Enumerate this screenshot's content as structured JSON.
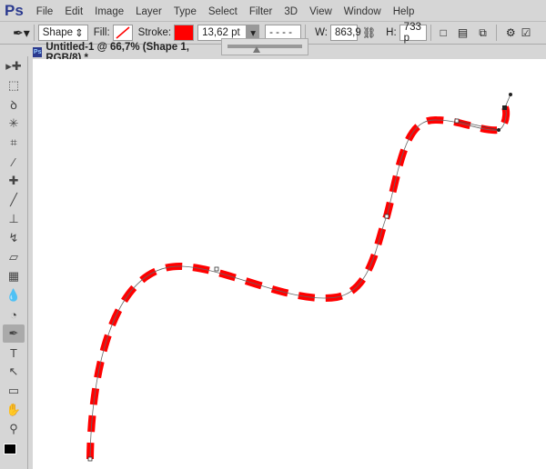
{
  "app": {
    "logo": "Ps"
  },
  "menu": [
    "File",
    "Edit",
    "Image",
    "Layer",
    "Type",
    "Select",
    "Filter",
    "3D",
    "View",
    "Window",
    "Help"
  ],
  "options": {
    "tool_icon": "pen-icon",
    "mode": "Shape",
    "fill_label": "Fill:",
    "stroke_label": "Stroke:",
    "stroke_color": "#ff0000",
    "stroke_width": "13,62 pt",
    "stroke_type": "- - - -",
    "w_label": "W:",
    "w_value": "863,9",
    "h_label": "H:",
    "h_value": "733 p"
  },
  "document": {
    "title": "Untitled-1 @ 66,7% (Shape 1, RGB/8) *"
  },
  "tools": [
    "move",
    "marquee",
    "lasso",
    "magic-wand",
    "crop",
    "eyedropper",
    "healing",
    "brush",
    "stamp",
    "history-brush",
    "eraser",
    "gradient",
    "blur",
    "dodge",
    "pen",
    "type",
    "path-select",
    "rectangle",
    "hand",
    "zoom"
  ],
  "active_tool": "pen",
  "path": {
    "stroke": "#ff0000"
  }
}
